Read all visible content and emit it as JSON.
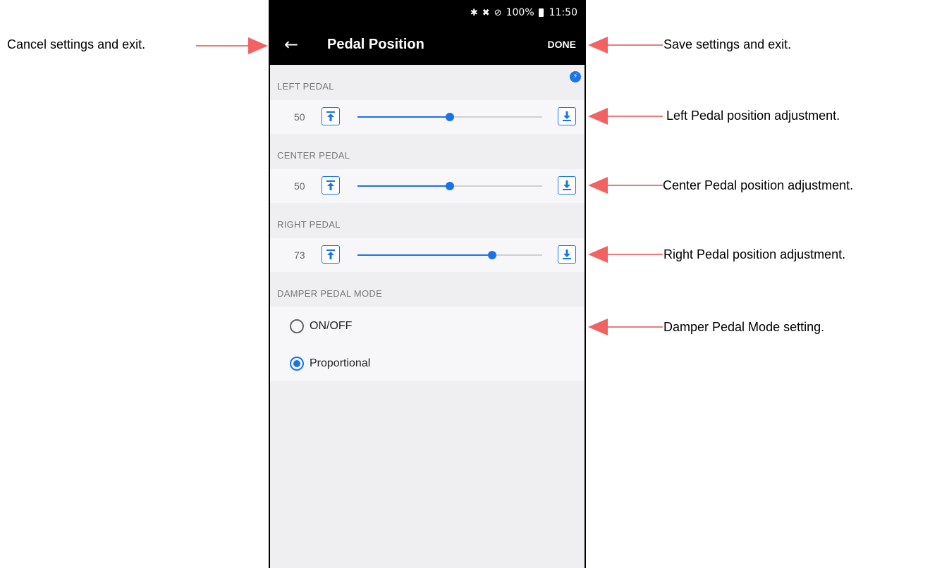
{
  "statusbar": {
    "icons": [
      "bluetooth-icon",
      "vibrate-mute-icon",
      "do-not-disturb-icon",
      "battery-icon"
    ],
    "battery": "100%",
    "time": "11:50"
  },
  "appbar": {
    "back_icon": "←",
    "title": "Pedal Position",
    "done_label": "DONE"
  },
  "sliders": [
    {
      "header": "LEFT PEDAL",
      "value": "50",
      "level": 0.5
    },
    {
      "header": "CENTER PEDAL",
      "value": "50",
      "level": 0.5
    },
    {
      "header": "RIGHT PEDAL",
      "value": "73",
      "level": 0.73
    }
  ],
  "damper": {
    "header": "DAMPER PEDAL MODE",
    "options": [
      {
        "label": "ON/OFF",
        "selected": false
      },
      {
        "label": "Proportional",
        "selected": true
      }
    ]
  },
  "annotations": {
    "cancel": "Cancel settings and exit.",
    "save": "Save settings and exit.",
    "left": "Left Pedal position adjustment.",
    "center": "Center Pedal position adjustment.",
    "right": "Right Pedal position adjustment.",
    "damper": "Damper Pedal Mode setting."
  },
  "colors": {
    "accent": "#1a73e8",
    "arrow": "#f26262",
    "appbar": "#000000",
    "background": "#efeff1"
  }
}
